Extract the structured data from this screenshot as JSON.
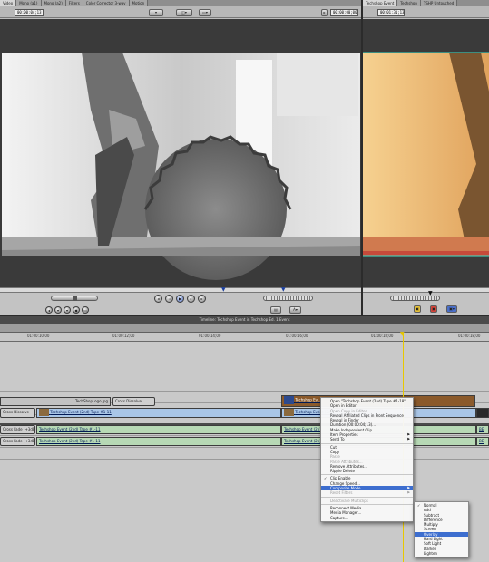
{
  "viewer": {
    "tabs": [
      "Video",
      "Mono (a1)",
      "Mono (a2)",
      "Filters",
      "Color Corrector 3-way",
      "Motion"
    ],
    "duration_tc": "00:00:04;13",
    "current_tc": "00:00:00;00"
  },
  "canvas": {
    "tabs": [
      "Techshop Event",
      "Techshop",
      "TSHP Untouched"
    ],
    "current_tc": "00:01:31;13"
  },
  "timeline": {
    "title": "Timeline: Techshop Event in Techshop Ed. 1 Event",
    "ruler": [
      "01:00:10;00",
      "01:00:12;00",
      "01:00:14;00",
      "01:00:16;00",
      "01:00:18;00"
    ],
    "clips": {
      "still": "TechShopLogo.jpg",
      "cross_dissolve": "Cross Dissolve",
      "cross_dissolve_left": "Cross Dissolve",
      "v_clip_a": "Techshop Event (2nd) Tape #1-11",
      "v_clip_b": "Techshop Ev...",
      "v_clip_c": "Techshop Event (2nd)",
      "overlay_clip": "Techshop Ev...",
      "a_clip_a": "Techshop Event (2nd) Tape #1-11",
      "a_clip_b": "Techshop Event (2n)",
      "a_clip_c": "Techshop Event (2nd) Tape #1-11",
      "a_clip_d": "Techshop Event (2n)",
      "cross_fade_1": "Cross Fade (+3dB)",
      "cross_fade_2": "Cross Fade (+3dB)",
      "edge_1": "BE",
      "edge_2": "BE"
    }
  },
  "context_menu": {
    "items": [
      {
        "label": "Open \"Techshop Event (2nd) Tape #1-18\"",
        "enabled": true
      },
      {
        "label": "Open in Editor",
        "enabled": true
      },
      {
        "label": "Open Copy in Editor",
        "enabled": false
      },
      {
        "label": "Reveal Affiliated Clips in Front Sequence",
        "enabled": true
      },
      {
        "label": "Reveal in Finder",
        "enabled": true
      },
      {
        "label": "Duration (00:00:04;13)...",
        "enabled": true
      },
      {
        "label": "Make Independent Clip",
        "enabled": true
      },
      {
        "label": "Item Properties",
        "enabled": true,
        "submenu": true
      },
      {
        "label": "Send To",
        "enabled": true,
        "submenu": true
      },
      {
        "sep": true
      },
      {
        "label": "Cut",
        "enabled": true
      },
      {
        "label": "Copy",
        "enabled": true
      },
      {
        "label": "Paste",
        "enabled": false
      },
      {
        "label": "Paste Attributes...",
        "enabled": false
      },
      {
        "label": "Remove Attributes...",
        "enabled": true
      },
      {
        "label": "Ripple Delete",
        "enabled": true
      },
      {
        "sep": true
      },
      {
        "label": "Clip Enable",
        "enabled": true,
        "checked": true
      },
      {
        "label": "Change Speed...",
        "enabled": true
      },
      {
        "label": "Composite Mode",
        "enabled": true,
        "submenu": true,
        "highlighted": true
      },
      {
        "label": "Reset Filters",
        "enabled": false,
        "submenu": true
      },
      {
        "sep": true
      },
      {
        "label": "Deactivate Multiclips",
        "enabled": false
      },
      {
        "sep": true
      },
      {
        "label": "Reconnect Media...",
        "enabled": true
      },
      {
        "label": "Media Manager...",
        "enabled": true
      },
      {
        "label": "Capture...",
        "enabled": true
      }
    ]
  },
  "composite_submenu": {
    "items": [
      {
        "label": "Normal",
        "checked": true
      },
      {
        "label": "Add"
      },
      {
        "label": "Subtract"
      },
      {
        "label": "Difference"
      },
      {
        "label": "Multiply"
      },
      {
        "label": "Screen"
      },
      {
        "label": "Overlay",
        "highlighted": true
      },
      {
        "label": "Hard Light"
      },
      {
        "label": "Soft Light"
      },
      {
        "label": "Darken"
      },
      {
        "label": "Lighten"
      }
    ]
  },
  "colors": {
    "menu_highlight": "#3d6ecf",
    "video_clip": "#a9c6e7",
    "audio_clip": "#b7d9b5",
    "playhead": "#e8c800"
  },
  "icons": [
    "play-icon",
    "prev-edit-icon",
    "next-edit-icon",
    "loop-icon",
    "mark-in-icon",
    "mark-out-icon",
    "playhead-icon"
  ]
}
